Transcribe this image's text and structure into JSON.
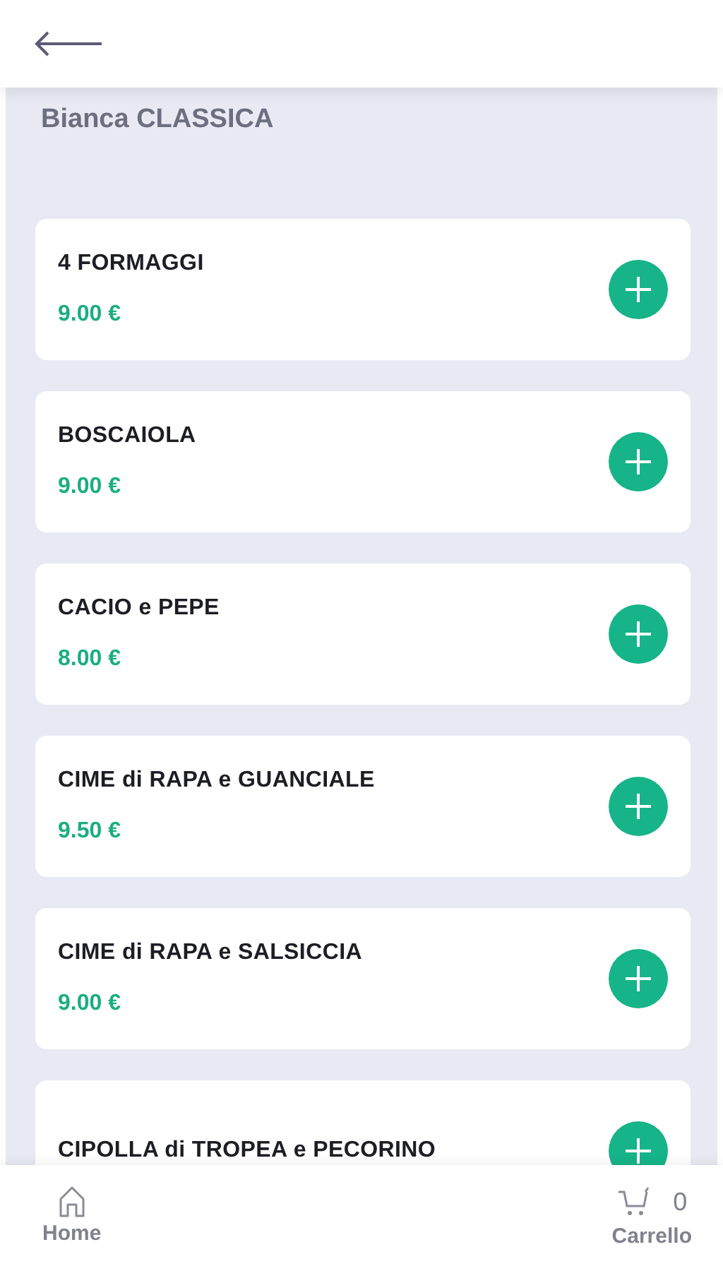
{
  "category": "Bianca CLASSICA",
  "products": [
    {
      "name": "4 FORMAGGI",
      "price": "9.00 €"
    },
    {
      "name": "BOSCAIOLA",
      "price": "9.00 €"
    },
    {
      "name": "CACIO e PEPE",
      "price": "8.00 €"
    },
    {
      "name": "CIME di RAPA e GUANCIALE",
      "price": "9.50 €"
    },
    {
      "name": "CIME di RAPA e SALSICCIA",
      "price": "9.00 €"
    },
    {
      "name": "CIPOLLA di TROPEA e PECORINO"
    }
  ],
  "bottom_nav": {
    "home_label": "Home",
    "cart_count": "0",
    "cart_label": "Carrello"
  }
}
